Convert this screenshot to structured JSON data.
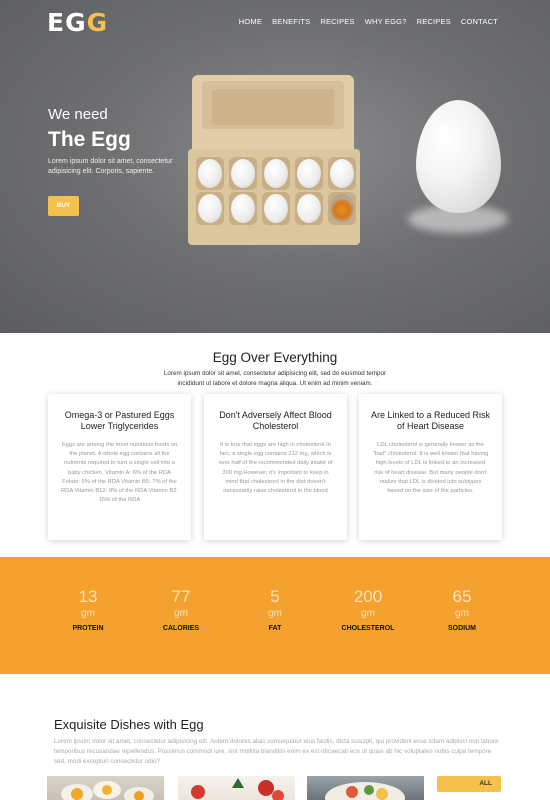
{
  "brand": {
    "prefix": "EG",
    "accent": "G",
    "accent_color": "#f5c14d"
  },
  "nav": [
    "HOME",
    "BENEFITS",
    "RECIPES",
    "WHY EGG?",
    "RECIPES",
    "CONTACT"
  ],
  "hero": {
    "subtitle": "We need",
    "title": "The Egg",
    "text": "Lorem ipsum dolor sit amet, consectetur adipisicing elit. Corporis, sapiente.",
    "button": "BUY"
  },
  "features": {
    "title": "Egg Over Everything",
    "lead": "Lorem ipsum dolor sit amet, consectetur adipisicing elit, sed do eiusmod tempor incididunt ut labore et dolore magna aliqua. Ut enim ad minim veniam.",
    "cards": [
      {
        "title": "Omega-3 or Pastured Eggs Lower Triglycerides",
        "text": "Eggs are among the most nutritious foods on the planet. A whole egg contains all the nutrients required to turn a single cell into a baby chicken. Vitamin A: 6% of the RDA Folate: 5% of the RDA Vitamin B5: 7% of the RDA Vitamin B12: 9% of the RDA Vitamin B2: 15% of the RDA"
      },
      {
        "title": "Don't Adversely Affect Blood Cholesterol",
        "text": "It is true that eggs are high in cholesterol.In fact, a single egg contains 212 mg, which is over half of the recommended daily intake of 300 mg.However, it's important to keep in mind that cholesterol in the diet doesn't necessarily raise cholesterol in the blood"
      },
      {
        "title": "Are Linked to a Reduced Risk of Heart Disease",
        "text": "LDL cholesterol is generally known as the \"bad\" cholesterol. It is well known that having high levels of LDL is linked to an increased risk of heart disease. But many people don't realize that LDL is divided into subtypes based on the size of the particles."
      }
    ]
  },
  "stats": [
    {
      "value": "13",
      "unit": "gm",
      "label": "PROTEIN"
    },
    {
      "value": "77",
      "unit": "gm",
      "label": "CALORIES"
    },
    {
      "value": "5",
      "unit": "gm",
      "label": "FAT"
    },
    {
      "value": "200",
      "unit": "gm",
      "label": "CHOLESTEROL"
    },
    {
      "value": "65",
      "unit": "gm",
      "label": "SODIUM"
    }
  ],
  "dishes": {
    "title": "Exquisite Dishes with Egg",
    "text": "Lorem ipsum dolor sit amet, consectetur adipisicing elit. Autem dolores alias consequatur eius facilis, dicta suscipit, qui provident esse totam adipisci non labore temporibus recusandae repellendus. Possimus commodi iure, sint mollitia blanditiis enim ex est obcaecati eos ut quasi ab hic voluptates nobis culpa tempore sed, modi excepturi consectetur odio?",
    "filter_all": "ALL"
  }
}
